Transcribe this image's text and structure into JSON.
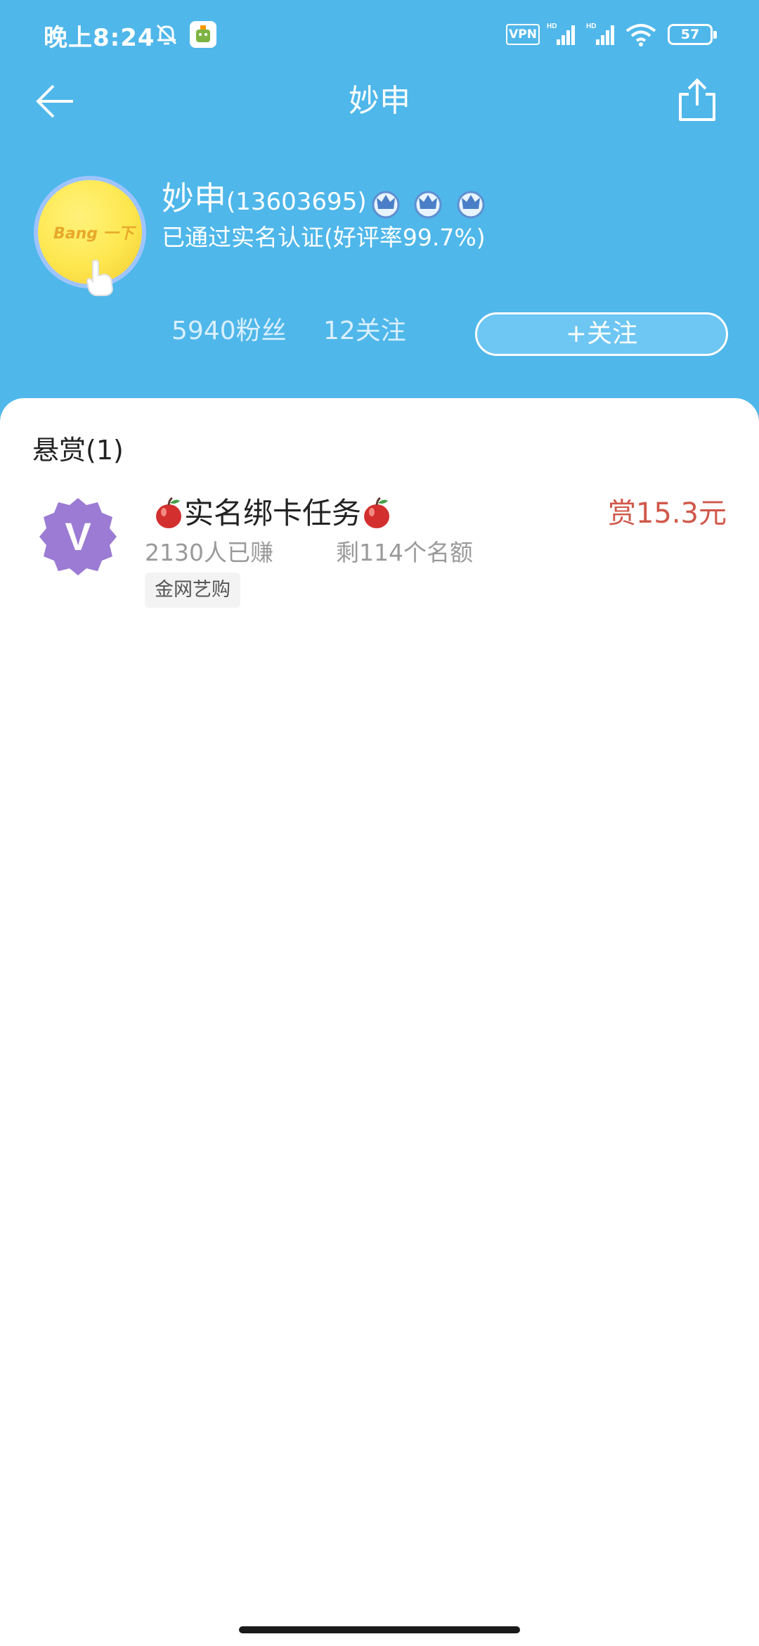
{
  "status_bar": {
    "time": "晚上8:24",
    "vpn": "VPN",
    "battery": "57",
    "icons": [
      "bell-off-icon",
      "android-app-icon",
      "vpn-icon",
      "hd-signal-icon",
      "hd-signal-icon",
      "wifi-icon",
      "battery-icon"
    ]
  },
  "nav": {
    "title": "妙申",
    "back_icon": "arrow-left-icon",
    "share_icon": "share-icon"
  },
  "profile": {
    "avatar_text": "Bang 一下",
    "name": "妙申",
    "id": "(13603695)",
    "verify_text": "已通过实名认证(好评率99.7%)",
    "fans": "5940粉丝",
    "following": "12关注",
    "follow_button": "+关注"
  },
  "rewards": {
    "section_title": "悬赏(1)",
    "items": [
      {
        "logo_letter": "V",
        "title": "实名绑卡任务",
        "reward": "赏15.3元",
        "earned": "2130人已赚",
        "remaining": "剩114个名额",
        "tag": "金网艺购"
      }
    ]
  },
  "colors": {
    "header": "#4fb7ea",
    "reward": "#d0584a",
    "logo": "#9b7bd3"
  }
}
